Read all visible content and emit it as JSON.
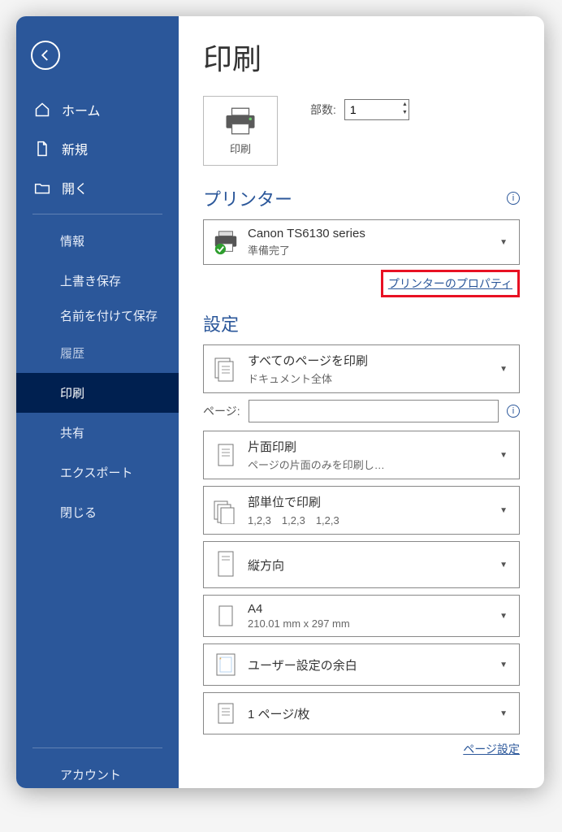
{
  "sidebar": {
    "navItems": [
      {
        "label": "ホーム"
      },
      {
        "label": "新規"
      },
      {
        "label": "開く"
      }
    ],
    "subItems": [
      {
        "label": "情報"
      },
      {
        "label": "上書き保存"
      },
      {
        "label": "名前を付けて保存"
      },
      {
        "label": "履歴"
      },
      {
        "label": "印刷",
        "active": true
      },
      {
        "label": "共有"
      },
      {
        "label": "エクスポート"
      },
      {
        "label": "閉じる"
      }
    ],
    "account": "アカウント"
  },
  "main": {
    "title": "印刷",
    "printBtnLabel": "印刷",
    "copiesLabel": "部数:",
    "copiesValue": "1",
    "printerSection": "プリンター",
    "printer": {
      "name": "Canon TS6130 series",
      "status": "準備完了"
    },
    "printerPropertiesLink": "プリンターのプロパティ",
    "settingsSection": "設定",
    "pagesLabel": "ページ:",
    "settings": {
      "printRange": {
        "main": "すべてのページを印刷",
        "sub": "ドキュメント全体"
      },
      "duplex": {
        "main": "片面印刷",
        "sub": "ページの片面のみを印刷し…"
      },
      "collate": {
        "main": "部単位で印刷",
        "sub": "1,2,3　1,2,3　1,2,3"
      },
      "orientation": {
        "main": "縦方向"
      },
      "paper": {
        "main": "A4",
        "sub": "210.01 mm x 297 mm"
      },
      "margins": {
        "main": "ユーザー設定の余白"
      },
      "pagesPerSheet": {
        "main": "1 ページ/枚"
      }
    },
    "pageSetupLink": "ページ設定"
  }
}
